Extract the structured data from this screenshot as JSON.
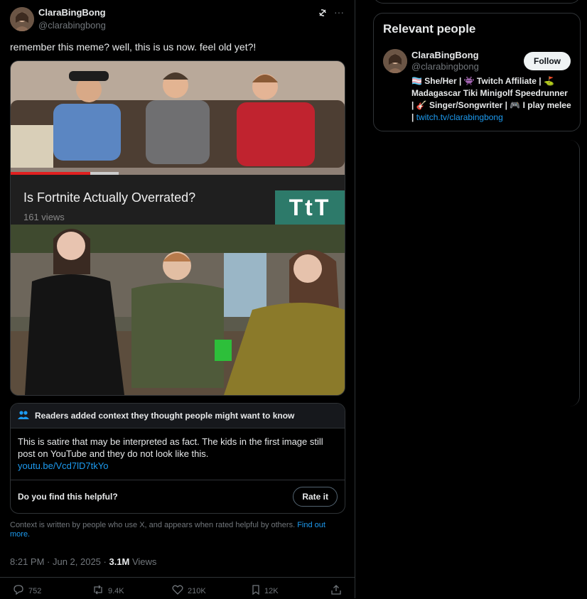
{
  "tweet": {
    "display_name": "ClaraBingBong",
    "handle": "@clarabingbong",
    "text": "remember this meme? well, this is us now. feel old yet?!",
    "video_title": "Is Fortnite Actually Overrated?",
    "video_views": "161 views",
    "channel_logo_text": "TtT",
    "timestamp": "8:21 PM · Jun 2, 2025 · ",
    "views_count": "3.1M",
    "views_label": " Views"
  },
  "note": {
    "header": "Readers added context they thought people might want to know",
    "body": "This is satire that may be interpreted as fact. The kids in the first image still post on YouTube and they do not look like this.",
    "link": "youtu.be/Vcd7lD7tkYo",
    "helpful_question": "Do you find this helpful?",
    "rate_label": "Rate it",
    "disclaimer": "Context is written by people who use X, and appears when rated helpful by others.",
    "find_out_more": "Find out more."
  },
  "actions": {
    "replies": "752",
    "reposts": "9.4K",
    "likes": "210K",
    "bookmarks": "12K"
  },
  "sidebar": {
    "title": "Relevant people",
    "person_name": "ClaraBingBong",
    "person_handle": "@clarabingbong",
    "follow_label": "Follow",
    "bio_line1": "🏳️‍⚧️ She/Her | 👾 Twitch Affiliate | ⛳",
    "bio_line2": "Madagascar Tiki Minigolf Speedrunner",
    "bio_line3": "| 🎸 Singer/Songwriter | 🎮 I play melee",
    "bio_link": "twitch.tv/clarabingbong"
  },
  "colors": {
    "accent": "#1d9bf0",
    "border": "#2f3336",
    "muted": "#71767b"
  }
}
